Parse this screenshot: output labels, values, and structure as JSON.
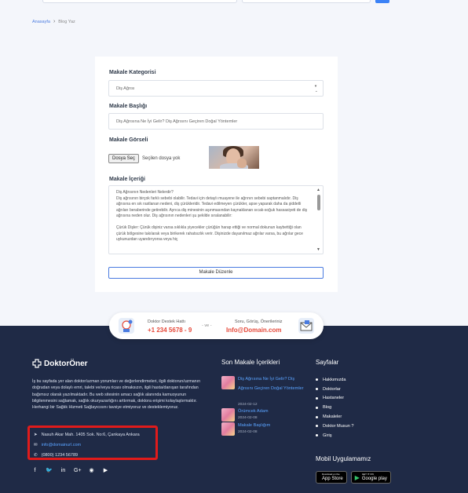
{
  "breadcrumb": {
    "home": "Anasayfa",
    "current": "Blog Yaz"
  },
  "form": {
    "category_label": "Makale Kategorisi",
    "category_value": "Diş Ağrısı",
    "title_label": "Makale Başlığı",
    "title_value": "Diş Ağrısına Ne İyi Gelir? Diş Ağrısını Geçiren Doğal Yöntemler",
    "image_label": "Makale Görseli",
    "file_button": "Dosya Seç",
    "file_status": "Seçilen dosya yok",
    "content_label": "Makale İçeriği",
    "content_p1": "Diş Ağrısının Nedenleri Nelerdir?",
    "content_p2": "Diş ağrısının birçok farklı sebebi olabilir. Tedavi için detaylı muayene ile ağrının sebebi saptanmalıdır. Diş ağrısına en sık rastlanan nedeni, diş çürükleridir. Tedavi edilmeyen çürükler, apse yaparak daha da şiddetli ağrıları beraberinde getirebilir. Ayrıca diş minesinin aşınmasından kaynaklanan sıcak-soğuk hassasiyeti de diş ağrısına neden olur. Diş ağrısının nedenleri şu şekilde sıralanabilir:",
    "content_p3": "Çürük Dişler: Çürük dişiniz varsa sıklıkla yiyecekler çürüğün harap ettiği ve normal dokunun kaybettiği olan çürük bölgesine takılarak veya birikerek rahatsızlık verir. Dişinizde dayanılmaz ağrılar varsa, bu ağrılar gece uykunuzdan uyandırıyorsa veya hiç",
    "submit": "Makale Düzenle"
  },
  "contact_bar": {
    "hotline_label": "Doktor Destek Hattı",
    "hotline_number": "+1 234 5678 - 9",
    "separator": "- ve -",
    "mail_label": "Soru, Görüş, Önerileriniz",
    "mail_value": "Info@Domain.com"
  },
  "footer": {
    "brand": "DoktorÖner",
    "about": "İş bu sayfada yer alan doktor/uzman yorumları ve değerlendirmeleri, ilgili doktorun/uzmanın doğrudan veya dolaylı emri, talebi ve/veya ricası olmaksızın, ilgili hasta/danışan tarafından bağımsız olarak yazılmaktadır. Bu web sitesinin amacı sağlık alanında kamuoyunun bilgilenmesini sağlamak, sağlık okuryazarlığını arttırmak, doktora erişimi kolaylaştırmaktır. Herhangi bir Sağlık Hizmeti Sağlayıcısını tavsiye etmiyoruz ve desteklemiyoruz.",
    "address": "Nasuh Akar Mah. 1405 Sok. No:6, Çankaya Ankara",
    "email": "info@domainurl.com",
    "phone": "(0800) 1234 56789",
    "recent_title": "Son Makale İçerikleri",
    "recent": [
      {
        "title": "Diş Ağrısına Ne İyi Gelir? Diş Ağrısını Geçiren Doğal Yöntemler",
        "date": "2024-02-12"
      },
      {
        "title": "Örümcek Adam",
        "date": "2024-02-08"
      },
      {
        "title": "Makale Başlığım",
        "date": "2024-02-08"
      }
    ],
    "links_title": "Sayfalar",
    "links": [
      "Hakkımızda",
      "Doktorlar",
      "Hastaneler",
      "Blog",
      "Makaleler",
      "Doktor Musun ?",
      "Giriş"
    ],
    "apps_title": "Mobil Uygulamamız",
    "appstore_small": "Download on the",
    "appstore_big": "App Store",
    "googleplay_small": "GET IT ON",
    "googleplay_big": "Google play"
  },
  "colors": {
    "accent": "#4a7be0",
    "footer_bg": "#1f2a46",
    "highlight": "#e01b1b",
    "hotline": "#e64a3b"
  }
}
